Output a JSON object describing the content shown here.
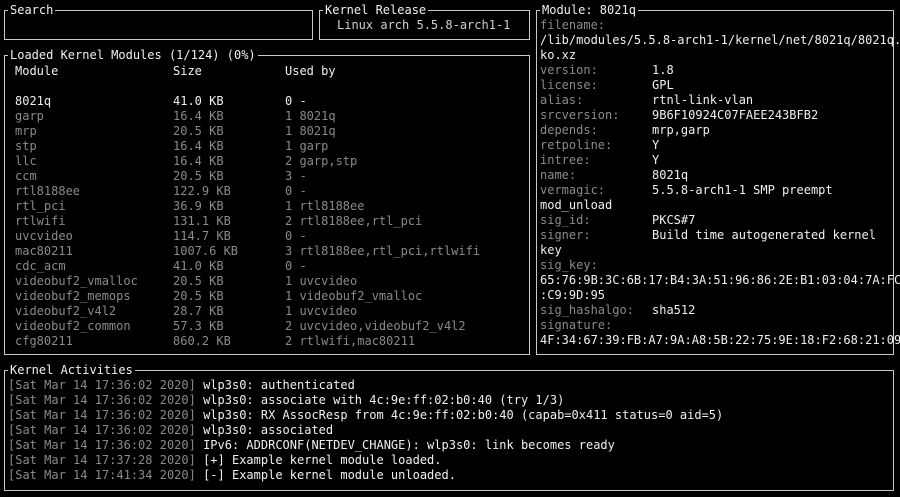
{
  "search": {
    "title": "Search"
  },
  "kernel_release": {
    "title": "Kernel Release",
    "value": "Linux arch 5.5.8-arch1-1"
  },
  "modules": {
    "title": "Loaded Kernel Modules (1/124) (0%)",
    "columns": {
      "module": "Module",
      "size": "Size",
      "used_by": "Used by"
    },
    "rows": [
      {
        "name": "8021q",
        "size": "41.0 KB",
        "used_by": "0 -",
        "selected": true
      },
      {
        "name": "garp",
        "size": "16.4 KB",
        "used_by": "1 8021q"
      },
      {
        "name": "mrp",
        "size": "20.5 KB",
        "used_by": "1 8021q"
      },
      {
        "name": "stp",
        "size": "16.4 KB",
        "used_by": "1 garp"
      },
      {
        "name": "llc",
        "size": "16.4 KB",
        "used_by": "2 garp,stp"
      },
      {
        "name": "ccm",
        "size": "20.5 KB",
        "used_by": "3 -"
      },
      {
        "name": "rtl8188ee",
        "size": "122.9 KB",
        "used_by": "0 -"
      },
      {
        "name": "rtl_pci",
        "size": "36.9 KB",
        "used_by": "1 rtl8188ee"
      },
      {
        "name": "rtlwifi",
        "size": "131.1 KB",
        "used_by": "2 rtl8188ee,rtl_pci"
      },
      {
        "name": "uvcvideo",
        "size": "114.7 KB",
        "used_by": "0 -"
      },
      {
        "name": "mac80211",
        "size": "1007.6 KB",
        "used_by": "3 rtl8188ee,rtl_pci,rtlwifi"
      },
      {
        "name": "cdc_acm",
        "size": "41.0 KB",
        "used_by": "0 -"
      },
      {
        "name": "videobuf2_vmalloc",
        "size": "20.5 KB",
        "used_by": "1 uvcvideo"
      },
      {
        "name": "videobuf2_memops",
        "size": "20.5 KB",
        "used_by": "1 videobuf2_vmalloc"
      },
      {
        "name": "videobuf2_v4l2",
        "size": "28.7 KB",
        "used_by": "1 uvcvideo"
      },
      {
        "name": "videobuf2_common",
        "size": "57.3 KB",
        "used_by": "2 uvcvideo,videobuf2_v4l2"
      },
      {
        "name": "cfg80211",
        "size": "860.2 KB",
        "used_by": "2 rtlwifi,mac80211"
      }
    ]
  },
  "module_detail": {
    "title": "Module: 8021q",
    "lines": [
      {
        "key": "filename:"
      },
      {
        "text": "/lib/modules/5.5.8-arch1-1/kernel/net/8021q/8021q."
      },
      {
        "text": "ko.xz"
      },
      {
        "key": "version:",
        "value": "1.8"
      },
      {
        "key": "license:",
        "value": "GPL"
      },
      {
        "key": "alias:",
        "value": "rtnl-link-vlan"
      },
      {
        "key": "srcversion:",
        "value": "9B6F10924C07FAEE243BFB2"
      },
      {
        "key": "depends:",
        "value": "mrp,garp"
      },
      {
        "key": "retpoline:",
        "value": "Y"
      },
      {
        "key": "intree:",
        "value": "Y"
      },
      {
        "key": "name:",
        "value": "8021q"
      },
      {
        "key": "vermagic:",
        "value": "5.5.8-arch1-1 SMP preempt"
      },
      {
        "text": "mod_unload"
      },
      {
        "key": "sig_id:",
        "value": "PKCS#7"
      },
      {
        "key": "signer:",
        "value": "Build time autogenerated kernel"
      },
      {
        "text": "key"
      },
      {
        "key": "sig_key:"
      },
      {
        "text": "65:76:9B:3C:6B:17:B4:3A:51:96:86:2E:B1:03:04:7A:FC"
      },
      {
        "text": ":C9:9D:95"
      },
      {
        "key": "sig_hashalgo:",
        "value": "sha512"
      },
      {
        "key": "signature:"
      },
      {
        "text": "4F:34:67:39:FB:A7:9A:A8:5B:22:75:9E:18:F2:68:21:09"
      }
    ]
  },
  "activities": {
    "title": "Kernel Activities",
    "entries": [
      {
        "time": "[Sat Mar 14 17:36:02 2020]",
        "message": "wlp3s0: authenticated"
      },
      {
        "time": "[Sat Mar 14 17:36:02 2020]",
        "message": "wlp3s0: associate with 4c:9e:ff:02:b0:40 (try 1/3)"
      },
      {
        "time": "[Sat Mar 14 17:36:02 2020]",
        "message": "wlp3s0: RX AssocResp from 4c:9e:ff:02:b0:40 (capab=0x411 status=0 aid=5)"
      },
      {
        "time": "[Sat Mar 14 17:36:02 2020]",
        "message": "wlp3s0: associated"
      },
      {
        "time": "[Sat Mar 14 17:36:02 2020]",
        "message": "IPv6: ADDRCONF(NETDEV_CHANGE): wlp3s0: link becomes ready"
      },
      {
        "time": "[Sat Mar 14 17:37:28 2020]",
        "message": "[+] Example kernel module loaded."
      },
      {
        "time": "[Sat Mar 14 17:41:34 2020]",
        "message": "[-] Example kernel module unloaded."
      }
    ]
  }
}
